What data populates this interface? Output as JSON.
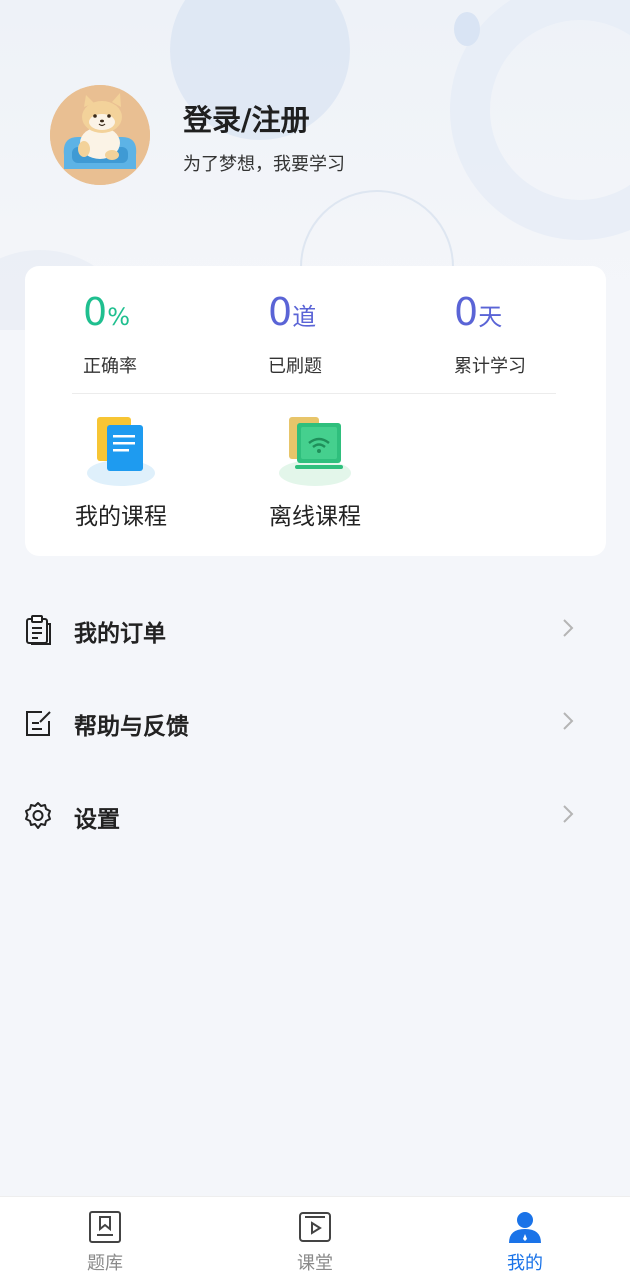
{
  "profile": {
    "title": "登录/注册",
    "subtitle": "为了梦想，我要学习"
  },
  "stats": [
    {
      "value": "0",
      "unit": "%",
      "label": "正确率",
      "color": "#1fbf8f"
    },
    {
      "value": "0",
      "unit": "道",
      "label": "已刷题",
      "color": "#5a64d6"
    },
    {
      "value": "0",
      "unit": "天",
      "label": "累计学习",
      "color": "#5a64d6"
    }
  ],
  "courses": {
    "my_courses": "我的课程",
    "offline_courses": "离线课程"
  },
  "menu": [
    {
      "label": "我的订单",
      "icon": "order-list-icon"
    },
    {
      "label": "帮助与反馈",
      "icon": "feedback-edit-icon"
    },
    {
      "label": "设置",
      "icon": "settings-gear-icon"
    }
  ],
  "tabbar": {
    "items": [
      {
        "label": "题库",
        "icon": "question-bank-icon",
        "active": false
      },
      {
        "label": "课堂",
        "icon": "classroom-play-icon",
        "active": false
      },
      {
        "label": "我的",
        "icon": "user-profile-icon",
        "active": true
      }
    ],
    "active_color": "#1a73e8",
    "inactive_color": "#8a8a8a"
  }
}
